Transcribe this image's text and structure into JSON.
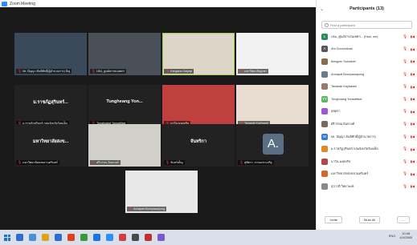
{
  "window": {
    "title": "Zoom Meeting",
    "controls": [
      "–",
      "☐",
      "✕"
    ]
  },
  "tiles": [
    {
      "name": "Mr. ปัญญา ตันติศักดิ์(ผู้อำนวยการ) ปัญ",
      "center": "",
      "bg": "#3a4a5a",
      "active": false
    },
    {
      "name": "LBU_ศูนย์สารสนเทศฯ",
      "center": "",
      "bg": "#4a5058",
      "active": false
    },
    {
      "name": "Kangana Saiyayi",
      "center": "",
      "bg": "#dcd5c8",
      "active": true
    },
    {
      "name": "มหาวิทยาลัยบูรพา",
      "center": "",
      "bg": "#f2f2f2",
      "active": false
    },
    {
      "name": "ม.ราชภัฏสุรินทร์ กลุ่มจังหวัดร้อยเอ็ด",
      "center": "ม.ราชภัฏสุรินทร์...",
      "bg": "#222",
      "active": false
    },
    {
      "name": "Tunghoang Yonsattisai",
      "center": "Tungheang Yon...",
      "bg": "#222",
      "active": false
    },
    {
      "name": "นาวิน มงคลกิจ",
      "center": "",
      "bg": "#c04040",
      "active": false
    },
    {
      "name": "Tanasak Kaybasek",
      "center": "",
      "bg": "#e8ddd0",
      "active": false
    },
    {
      "name": "มหาวิทยาลัยสงขลานครินทร์",
      "center": "มหาวิทยาลัยสงข...",
      "bg": "#222",
      "active": false
    },
    {
      "name": "ศรีวรรณ อินทวงศ์",
      "center": "",
      "bg": "#d0d0c8",
      "active": false
    },
    {
      "name": "จันทร์เพ็ญ",
      "center": "จันทริกา",
      "bg": "#222",
      "active": false
    },
    {
      "name": "สุพัตรา วรรณประเสริฐ",
      "center": "",
      "bg": "#222",
      "active": false,
      "letter": "A."
    },
    {
      "name": "Annapat Boonyawayong",
      "center": "",
      "bg": "#e8e8e8",
      "active": false
    }
  ],
  "panel": {
    "title": "Participants (13)",
    "search_placeholder": "Find a participant",
    "participants": [
      {
        "name": "LBU_ศูนย์สารสนเทศฯ... (Host, me)",
        "initial": "L",
        "color": "#2e8b57"
      },
      {
        "name": "Ahi Goonchinak",
        "initial": "A",
        "color": "#555"
      },
      {
        "name": "Bangorn Sukrabet",
        "initial": "",
        "color": "#8a6a4a"
      },
      {
        "name": "Annapat Boonyawayong",
        "initial": "",
        "color": "#6a7a8a"
      },
      {
        "name": "Tanasak Kaybasek",
        "initial": "",
        "color": "#9a7a6a"
      },
      {
        "name": "Tunghoang Yonsattisai",
        "initial": "TY",
        "color": "#5cb85c"
      },
      {
        "name": "สุพัตรา",
        "initial": "",
        "color": "#a05ad0"
      },
      {
        "name": "ศรีวรรณ อินทวงศ์",
        "initial": "",
        "color": "#7a6a5a"
      },
      {
        "name": "Mr. ปัญญา ตันติศักดิ์(ผู้อำนวยการ)",
        "initial": "M",
        "color": "#3a7bd5"
      },
      {
        "name": "ม.ราชภัฏสุรินทร์ กลุ่มจังหวัดร้อยเอ็ด",
        "initial": "",
        "color": "#e08a2a"
      },
      {
        "name": "นาวิน มงคลกิจ",
        "initial": "",
        "color": "#b04a4a"
      },
      {
        "name": "มหาวิทยาลัยสงขลานครินทร์",
        "initial": "",
        "color": "#d06a2a"
      },
      {
        "name": "สุภาวดี วิทยาพงษ์",
        "initial": "",
        "color": "#8a8a8a"
      }
    ],
    "footer": {
      "invite": "Invite",
      "mute_all": "Mute All",
      "more": "..."
    }
  },
  "taskbar": {
    "icons": [
      "#2d6fd1",
      "#4a90d9",
      "#e0a020",
      "#2d6fd1",
      "#e04020",
      "#3a9a3a",
      "#1a73e8",
      "#2d8cff",
      "#d04040",
      "#4a4a4a",
      "#c03030",
      "#7a5acd"
    ],
    "time": "10:08",
    "date": "4/4/2565",
    "lang": "ENG"
  }
}
